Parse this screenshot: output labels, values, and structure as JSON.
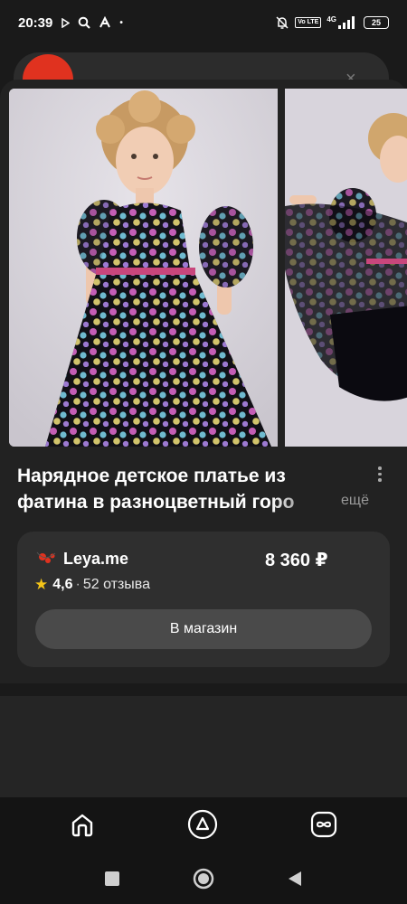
{
  "status_bar": {
    "time": "20:39",
    "network": "4G",
    "network_badge": "Vo LTE",
    "battery": "25"
  },
  "product": {
    "title_line1": "Нарядное детское платье из",
    "title_line2": "фатина в разноцветный горо",
    "more": "ещё"
  },
  "shop": {
    "name": "Leya.me",
    "price": "8 360 ₽",
    "rating": "4,6",
    "separator": "·",
    "reviews": "52 отзыва",
    "button_label": "В магазин"
  },
  "colors": {
    "background": "#1a1a1a",
    "sheet": "#222222",
    "card": "#2f2f2f",
    "button": "#4a4a4a",
    "star": "#f5c518",
    "brand_red": "#e0321f"
  },
  "icons": {
    "home": "home-icon",
    "alice": "alice-icon",
    "infinity": "infinity-icon",
    "star": "star-icon",
    "kebab": "more-vertical-icon"
  }
}
